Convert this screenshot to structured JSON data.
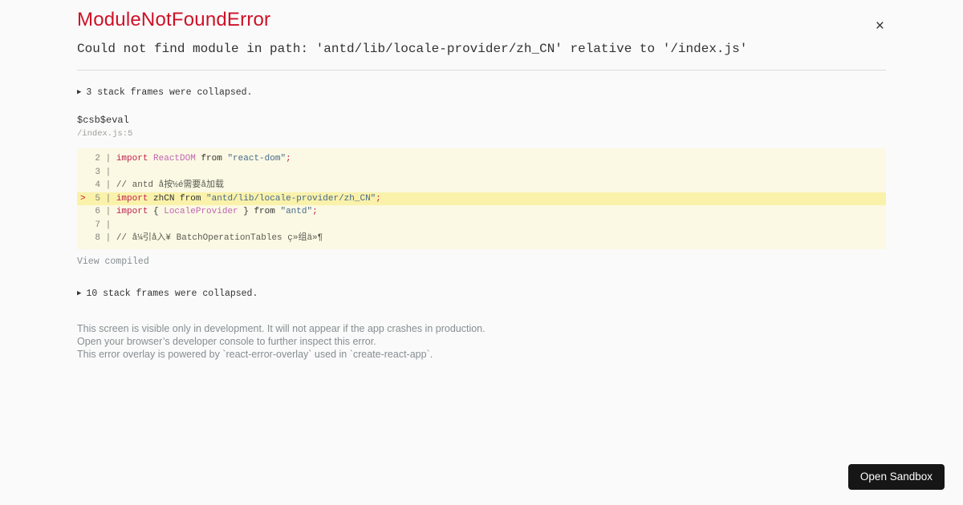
{
  "overlay": {
    "title": "ModuleNotFoundError",
    "message": "Could not find module in path: 'antd/lib/locale-provider/zh_CN' relative to '/index.js'",
    "close_label": "×"
  },
  "stack": {
    "toggle_arrow": "▶",
    "collapsed_top": "3 stack frames were collapsed.",
    "collapsed_bottom": "10 stack frames were collapsed.",
    "frame": {
      "function": "$csb$eval",
      "location": "/index.js:5"
    },
    "view_compiled": "View compiled"
  },
  "code": {
    "lines": [
      {
        "no": "2",
        "marker": "",
        "highlight": false,
        "tokens": [
          {
            "t": "keyword",
            "v": "import"
          },
          {
            "t": "plain",
            "v": " "
          },
          {
            "t": "class",
            "v": "ReactDOM"
          },
          {
            "t": "plain",
            "v": " from "
          },
          {
            "t": "string",
            "v": "\"react-dom\""
          },
          {
            "t": "keyword",
            "v": ";"
          }
        ]
      },
      {
        "no": "3",
        "marker": "",
        "highlight": false,
        "tokens": []
      },
      {
        "no": "4",
        "marker": "",
        "highlight": false,
        "tokens": [
          {
            "t": "comment",
            "v": "// antd å按½é需要å加载"
          }
        ]
      },
      {
        "no": "5",
        "marker": ">",
        "highlight": true,
        "tokens": [
          {
            "t": "keyword",
            "v": "import"
          },
          {
            "t": "plain",
            "v": " zhCN from "
          },
          {
            "t": "string",
            "v": "\"antd/lib/locale-provider/zh_CN\""
          },
          {
            "t": "keyword",
            "v": ";"
          }
        ]
      },
      {
        "no": "6",
        "marker": "",
        "highlight": false,
        "tokens": [
          {
            "t": "keyword",
            "v": "import"
          },
          {
            "t": "plain",
            "v": " { "
          },
          {
            "t": "class",
            "v": "LocaleProvider"
          },
          {
            "t": "plain",
            "v": " } from "
          },
          {
            "t": "string",
            "v": "\"antd\""
          },
          {
            "t": "keyword",
            "v": ";"
          }
        ]
      },
      {
        "no": "7",
        "marker": "",
        "highlight": false,
        "tokens": []
      },
      {
        "no": "8",
        "marker": "",
        "highlight": false,
        "tokens": [
          {
            "t": "comment",
            "v": "// å¼引å入¥ BatchOperationTables ç»组ä»¶"
          }
        ]
      }
    ]
  },
  "footer": {
    "lines": [
      "This screen is visible only in development. It will not appear if the app crashes in production.",
      "Open your browser’s developer console to further inspect this error.",
      "This error overlay is powered by `react-error-overlay` used in `create-react-app`."
    ]
  },
  "button": {
    "label": "Open Sandbox"
  },
  "colors": {
    "bg": "#fafafa",
    "text": "#333333",
    "accent_red": "#ce1126",
    "gray": "#878e91",
    "divider": "#dcdcdc",
    "code_bg": "#fbf9e3",
    "code_highlight_bg": "#faf2ab",
    "gutter": "#83837d",
    "keyword": "#bd1e4e",
    "class_name": "#c065b5",
    "string": "#46698c",
    "comment": "#5b5b55",
    "muted_location": "#9d9d98",
    "button_bg": "#161616",
    "button_text": "#fbfbfb"
  }
}
